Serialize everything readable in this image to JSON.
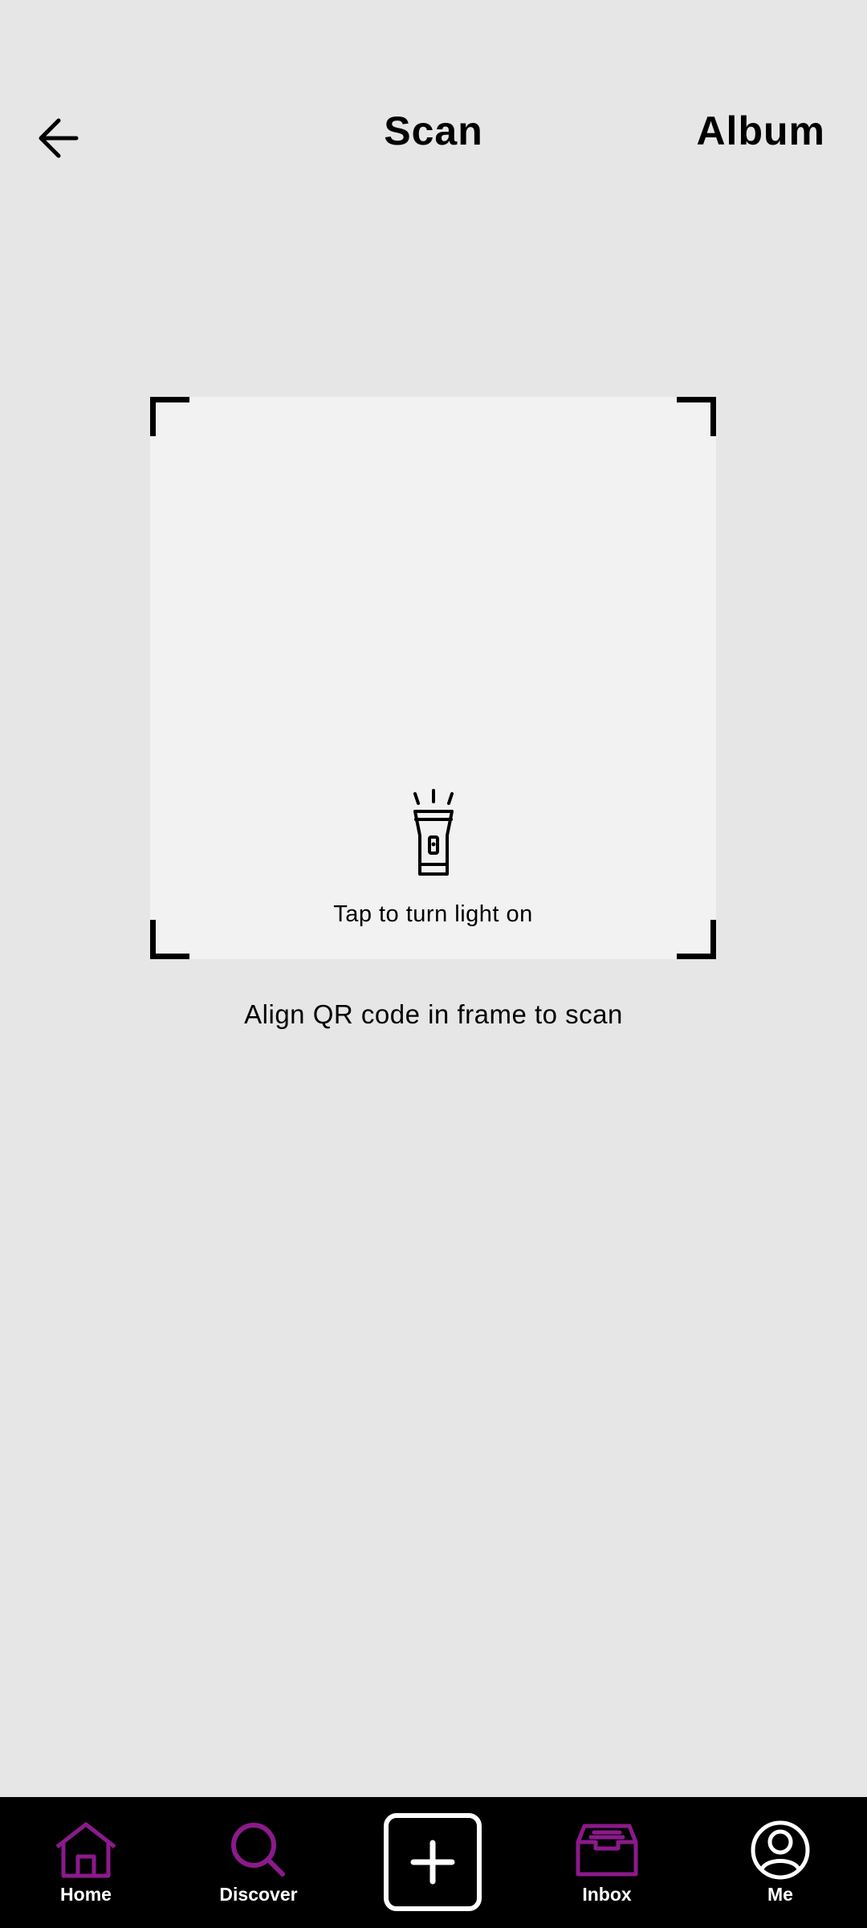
{
  "header": {
    "title": "Scan",
    "album_label": "Album",
    "back_icon": "arrow-left-icon"
  },
  "scanner": {
    "flash_label": "Tap to turn light on",
    "flash_icon": "flashlight-icon",
    "hint": "Align QR code in frame to scan"
  },
  "bottom_nav": {
    "accent_color": "#8b1a8b",
    "items": [
      {
        "label": "Home",
        "icon": "home-icon"
      },
      {
        "label": "Discover",
        "icon": "search-icon"
      },
      {
        "label": "",
        "icon": "plus-icon"
      },
      {
        "label": "Inbox",
        "icon": "inbox-icon"
      },
      {
        "label": "Me",
        "icon": "profile-icon"
      }
    ]
  }
}
